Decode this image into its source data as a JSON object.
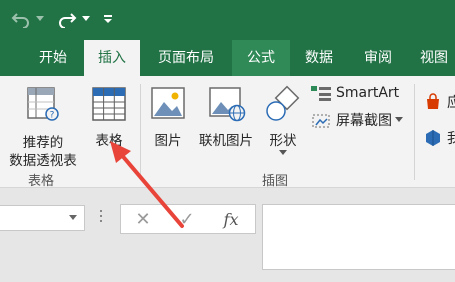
{
  "tabs": [
    {
      "label": ""
    },
    {
      "label": "开始"
    },
    {
      "label": "插入"
    },
    {
      "label": "页面布局"
    },
    {
      "label": "公式"
    },
    {
      "label": "数据"
    },
    {
      "label": "审阅"
    },
    {
      "label": "视图"
    }
  ],
  "ribbon": {
    "pivot_line1": "推荐的",
    "pivot_line2": "数据透视表",
    "table_label": "表格",
    "group_tables": "表格",
    "picture_label": "图片",
    "online_picture_label": "联机图片",
    "shapes_label": "形状",
    "group_illustrations": "插图",
    "smartart_label": "SmartArt",
    "screenshot_label": "屏幕截图",
    "apps_label_partial": "应",
    "my_label_partial": "我"
  },
  "formula_bar": {
    "cancel_glyph": "✕",
    "enter_glyph": "✓",
    "fx_label": "fx"
  },
  "colors": {
    "brand_green": "#217346",
    "ribbon_bg": "#f3f3f3",
    "annotation_arrow": "#e8443a"
  }
}
